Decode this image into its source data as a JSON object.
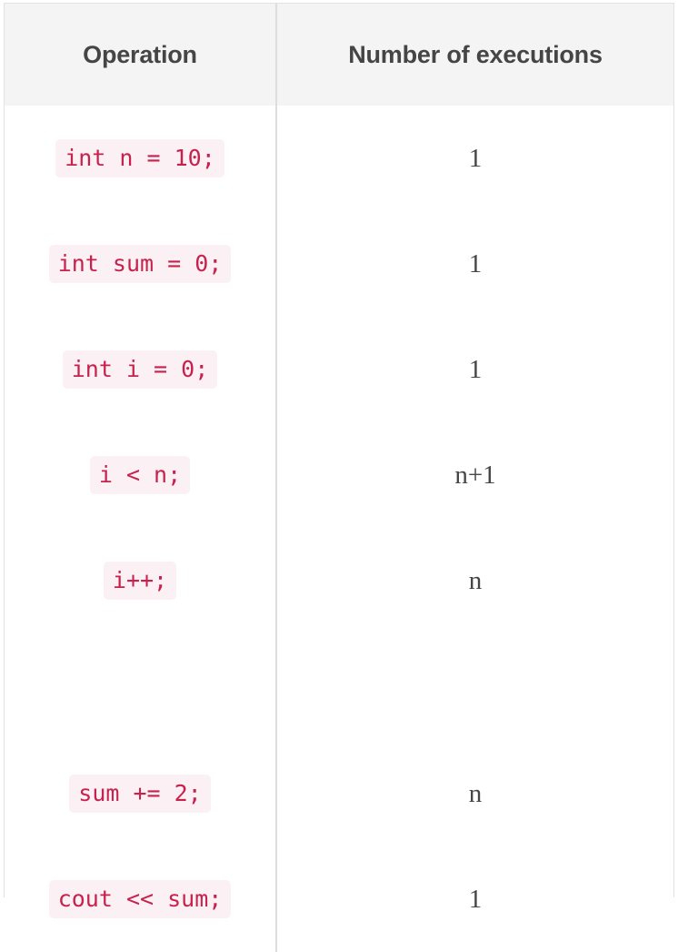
{
  "table": {
    "columns": [
      {
        "key": "operation",
        "label": "Operation"
      },
      {
        "key": "executions",
        "label": "Number of executions"
      }
    ],
    "rows": [
      {
        "operation": "int n = 10;",
        "executions": "1"
      },
      {
        "operation": "int sum = 0;",
        "executions": "1"
      },
      {
        "operation": "int i = 0;",
        "executions": "1"
      },
      {
        "operation": "i < n;",
        "executions": "n+1"
      },
      {
        "operation": "i++;",
        "executions": "n"
      },
      {
        "operation": "",
        "executions": ""
      },
      {
        "operation": "sum += 2;",
        "executions": "n"
      },
      {
        "operation": "cout << sum;",
        "executions": "1"
      }
    ]
  },
  "colors": {
    "header_background": "#f4f4f5",
    "header_text": "#454545",
    "border": "#e2e2e4",
    "column_divider": "#dddddf",
    "code_text": "#c7224e",
    "code_background": "#fbf0f3",
    "value_text": "#464646",
    "page_background": "#ffffff"
  }
}
